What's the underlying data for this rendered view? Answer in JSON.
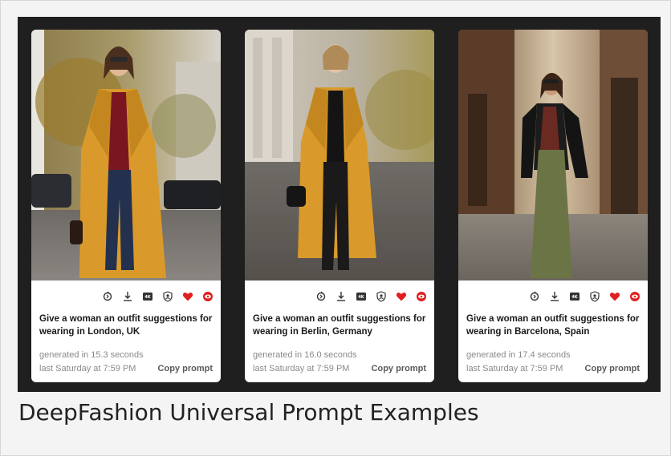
{
  "caption": "DeepFashion Universal Prompt Examples",
  "cards": [
    {
      "prompt": "Give a woman an outfit suggestions for wearing in London, UK",
      "generated": "generated in 15.3 seconds",
      "time": "last Saturday at 7:59 PM",
      "copy_label": "Copy prompt"
    },
    {
      "prompt": "Give a woman an outfit suggestions for wearing in Berlin, Germany",
      "generated": "generated in 16.0 seconds",
      "time": "last Saturday at 7:59 PM",
      "copy_label": "Copy prompt"
    },
    {
      "prompt": "Give a woman an outfit suggestions for wearing in Barcelona, Spain",
      "generated": "generated in 17.4 seconds",
      "time": "last Saturday at 7:59 PM",
      "copy_label": "Copy prompt"
    }
  ],
  "icons": [
    "remix-icon",
    "download-icon",
    "upscale-4k-icon",
    "avatar-shield-icon",
    "heart-icon",
    "eye-icon"
  ],
  "colors": {
    "gallery_bg": "#1f1f1f",
    "heart": "#e02020",
    "eye": "#e02020",
    "coat_mustard": "#d99a2b"
  }
}
